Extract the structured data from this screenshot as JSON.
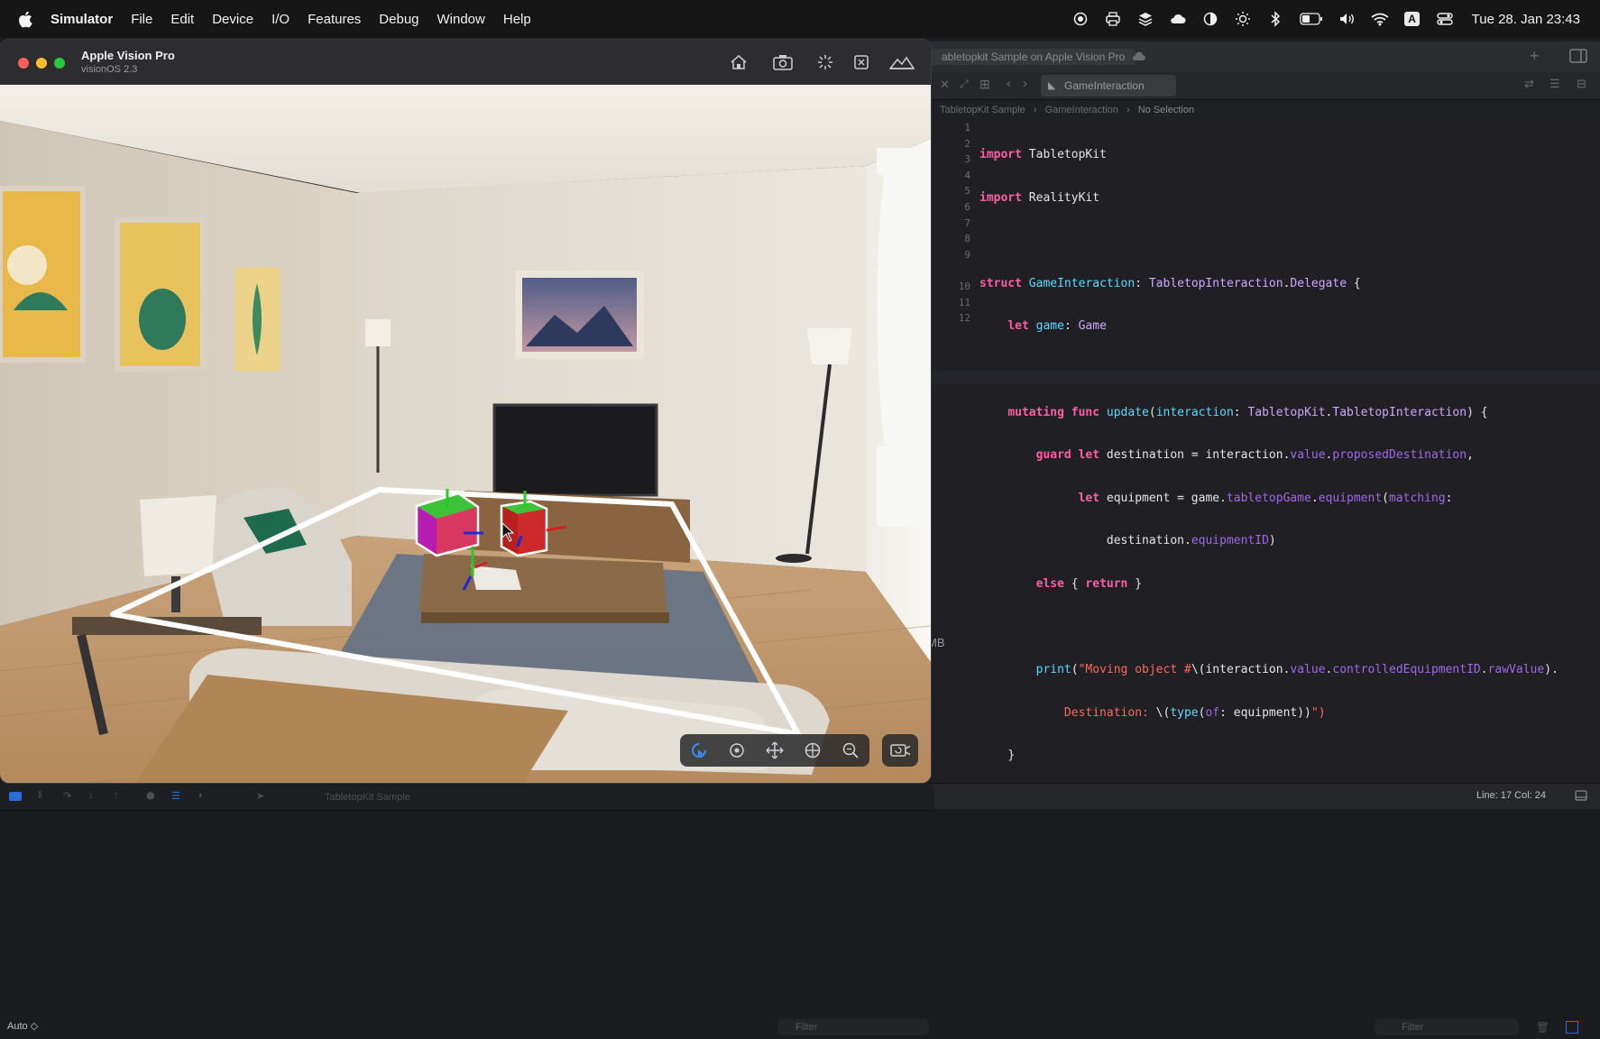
{
  "menubar": {
    "app_name": "Simulator",
    "items": [
      "File",
      "Edit",
      "Device",
      "I/O",
      "Features",
      "Debug",
      "Window",
      "Help"
    ],
    "keyboard_badge": "A",
    "clock": "Tue 28. Jan  23:43"
  },
  "simulator": {
    "device_name": "Apple Vision Pro",
    "os_version": "visionOS 2.3"
  },
  "xcode": {
    "window_tab_title": "abletopkit Sample on Apple Vision Pro",
    "file_tab": "GameInteraction",
    "jumpbar": [
      "TabletopKit Sample",
      "GameInteraction",
      "No Selection"
    ],
    "line_numbers": [
      "1",
      "2",
      "3",
      "4",
      "5",
      "6",
      "7",
      "8",
      "9",
      "",
      "10",
      "11",
      "12",
      "",
      "",
      "",
      ""
    ],
    "status_position": "Line: 17  Col: 24",
    "scheme_label": "TabletopKit Sample",
    "auto_label": "Auto ◇",
    "filter_placeholder": "Filter",
    "mb_label": "MB"
  },
  "code": {
    "l1_kw": "import",
    "l1_rest": " TabletopKit",
    "l2_kw": "import",
    "l2_rest": " RealityKit",
    "l4_kw": "struct",
    "l4_name": "GameInteraction",
    "l4_colon": ": ",
    "l4_proto": "TabletopInteraction",
    "l4_dot": ".",
    "l4_proto2": "Delegate",
    "l4_end": " {",
    "l5_kw": "let",
    "l5_prop": "game",
    "l5_colon": ": ",
    "l5_type": "Game",
    "l7_kw1": "mutating",
    "l7_kw2": "func",
    "l7_fn": "update",
    "l7_open": "(",
    "l7_param": "interaction",
    "l7_colon": ": ",
    "l7_type": "TabletopKit",
    "l7_dot": ".",
    "l7_type2": "TabletopInteraction",
    "l7_end": ") {",
    "l8_kw1": "guard",
    "l8_kw2": "let",
    "l8_mid": " destination = interaction.",
    "l8_p1": "value",
    "l8_dot": ".",
    "l8_p2": "proposedDestination",
    "l8_end": ",",
    "l9_kw": "let",
    "l9_mid": " equipment = game.",
    "l9_p1": "tabletopGame",
    "l9_dot": ".",
    "l9_p2": "equipment",
    "l9_open": "(",
    "l9_param": "matching",
    "l9_end": ":",
    "l9b_mid": "destination.",
    "l9b_p": "equipmentID",
    "l9b_end": ")",
    "l10_kw1": "else",
    "l10_open": " { ",
    "l10_kw2": "return",
    "l10_end": " }",
    "l12_fn": "print",
    "l12_open": "(",
    "l12_str": "\"Moving object #",
    "l12_interp": "\\(interaction.",
    "l12_p1": "value",
    "l12_dot": ".",
    "l12_p2": "controlledEquipmentID",
    "l12_dot2": ".",
    "l12_p3": "rawValue",
    "l12_end": ").",
    "l12b_str": "Destination: ",
    "l12b_interp": "\\(",
    "l12b_fn": "type",
    "l12b_open": "(",
    "l12b_param": "of",
    "l12b_mid": ": equipment))",
    "l12b_end": "\")",
    "l13": "}",
    "l14": "}"
  },
  "colors": {
    "accent_keyword": "#fc5fa3",
    "accent_type": "#5dd8ff",
    "accent_property": "#a167e6",
    "accent_string": "#fc6a5d"
  }
}
